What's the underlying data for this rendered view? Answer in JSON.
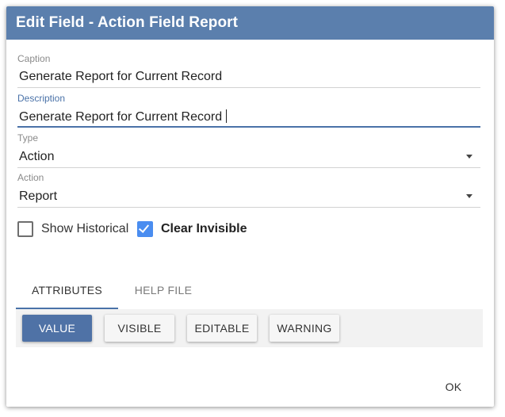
{
  "dialog": {
    "title": "Edit Field - Action Field Report",
    "header_color": "#5b7fad"
  },
  "fields": {
    "caption": {
      "label": "Caption",
      "value": "Generate Report for Current Record"
    },
    "description": {
      "label": "Description",
      "value": "Generate Report for Current Record",
      "focused": true
    },
    "type": {
      "label": "Type",
      "value": "Action",
      "icon": "dropdown-arrow-icon"
    },
    "action": {
      "label": "Action",
      "value": "Report",
      "icon": "dropdown-arrow-icon"
    }
  },
  "checkboxes": {
    "show_historical": {
      "label": "Show Historical",
      "checked": false
    },
    "clear_invisible": {
      "label": "Clear Invisible",
      "checked": true
    }
  },
  "tabs": [
    {
      "label": "ATTRIBUTES",
      "active": true
    },
    {
      "label": "HELP FILE",
      "active": false
    }
  ],
  "attribute_buttons": [
    {
      "label": "VALUE",
      "selected": true
    },
    {
      "label": "VISIBLE",
      "selected": false
    },
    {
      "label": "EDITABLE",
      "selected": false
    },
    {
      "label": "WARNING",
      "selected": false
    }
  ],
  "footer": {
    "ok_label": "OK"
  },
  "colors": {
    "accent": "#4a72a8",
    "checkbox_checked": "#4a8df0",
    "primary_button": "#4f72a6"
  }
}
